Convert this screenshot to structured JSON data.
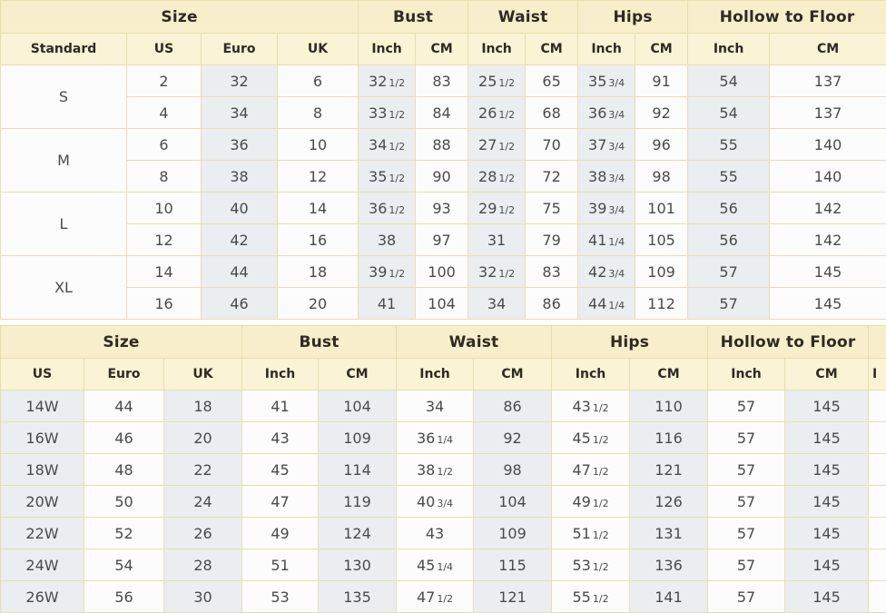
{
  "tables": [
    {
      "id": "standard-size-chart",
      "group_headers": [
        {
          "label": "Size",
          "span": 4
        },
        {
          "label": "Bust",
          "span": 2
        },
        {
          "label": "Waist",
          "span": 2
        },
        {
          "label": "Hips",
          "span": 2
        },
        {
          "label": "Hollow to Floor",
          "span": 2
        }
      ],
      "columns": [
        "Standard",
        "US",
        "Euro",
        "UK",
        "Inch",
        "CM",
        "Inch",
        "CM",
        "Inch",
        "CM",
        "Inch",
        "CM"
      ],
      "groups": [
        {
          "standard": "S",
          "rows": [
            [
              "2",
              "32",
              "6",
              "32 1/2",
              "83",
              "25 1/2",
              "65",
              "35 3/4",
              "91",
              "54",
              "137"
            ],
            [
              "4",
              "34",
              "8",
              "33 1/2",
              "84",
              "26 1/2",
              "68",
              "36 3/4",
              "92",
              "54",
              "137"
            ]
          ]
        },
        {
          "standard": "M",
          "rows": [
            [
              "6",
              "36",
              "10",
              "34 1/2",
              "88",
              "27 1/2",
              "70",
              "37 3/4",
              "96",
              "55",
              "140"
            ],
            [
              "8",
              "38",
              "12",
              "35 1/2",
              "90",
              "28 1/2",
              "72",
              "38 3/4",
              "98",
              "55",
              "140"
            ]
          ]
        },
        {
          "standard": "L",
          "rows": [
            [
              "10",
              "40",
              "14",
              "36 1/2",
              "93",
              "29 1/2",
              "75",
              "39 3/4",
              "101",
              "56",
              "142"
            ],
            [
              "12",
              "42",
              "16",
              "38",
              "97",
              "31",
              "79",
              "41 1/4",
              "105",
              "56",
              "142"
            ]
          ]
        },
        {
          "standard": "XL",
          "rows": [
            [
              "14",
              "44",
              "18",
              "39 1/2",
              "100",
              "32 1/2",
              "83",
              "42 3/4",
              "109",
              "57",
              "145"
            ],
            [
              "16",
              "46",
              "20",
              "41",
              "104",
              "34",
              "86",
              "44 1/4",
              "112",
              "57",
              "145"
            ]
          ]
        }
      ]
    },
    {
      "id": "plus-size-chart",
      "group_headers": [
        {
          "label": "Size",
          "span": 3
        },
        {
          "label": "Bust",
          "span": 2
        },
        {
          "label": "Waist",
          "span": 2
        },
        {
          "label": "Hips",
          "span": 2
        },
        {
          "label": "Hollow to Floor",
          "span": 2
        },
        {
          "label": "",
          "span": 1
        }
      ],
      "columns": [
        "US",
        "Euro",
        "UK",
        "Inch",
        "CM",
        "Inch",
        "CM",
        "Inch",
        "CM",
        "Inch",
        "CM",
        "I"
      ],
      "rows": [
        [
          "14W",
          "44",
          "18",
          "41",
          "104",
          "34",
          "86",
          "43 1/2",
          "110",
          "57",
          "145",
          ""
        ],
        [
          "16W",
          "46",
          "20",
          "43",
          "109",
          "36 1/4",
          "92",
          "45 1/2",
          "116",
          "57",
          "145",
          ""
        ],
        [
          "18W",
          "48",
          "22",
          "45",
          "114",
          "38 1/2",
          "98",
          "47 1/2",
          "121",
          "57",
          "145",
          ""
        ],
        [
          "20W",
          "50",
          "24",
          "47",
          "119",
          "40 3/4",
          "104",
          "49 1/2",
          "126",
          "57",
          "145",
          ""
        ],
        [
          "22W",
          "52",
          "26",
          "49",
          "124",
          "43",
          "109",
          "51 1/2",
          "131",
          "57",
          "145",
          ""
        ],
        [
          "24W",
          "54",
          "28",
          "51",
          "130",
          "45 1/4",
          "115",
          "53 1/2",
          "136",
          "57",
          "145",
          ""
        ],
        [
          "26W",
          "56",
          "30",
          "53",
          "135",
          "47 1/2",
          "121",
          "55 1/2",
          "141",
          "57",
          "145",
          ""
        ]
      ]
    }
  ],
  "colors": {
    "group_header_bg": "#f7eecb",
    "sub_header_bg": "#faf3d6",
    "border": "#e8dfae",
    "cell_bg": "#fcfcfc",
    "cell_shade_bg": "#ebedf0",
    "text": "#4a4a4a"
  }
}
